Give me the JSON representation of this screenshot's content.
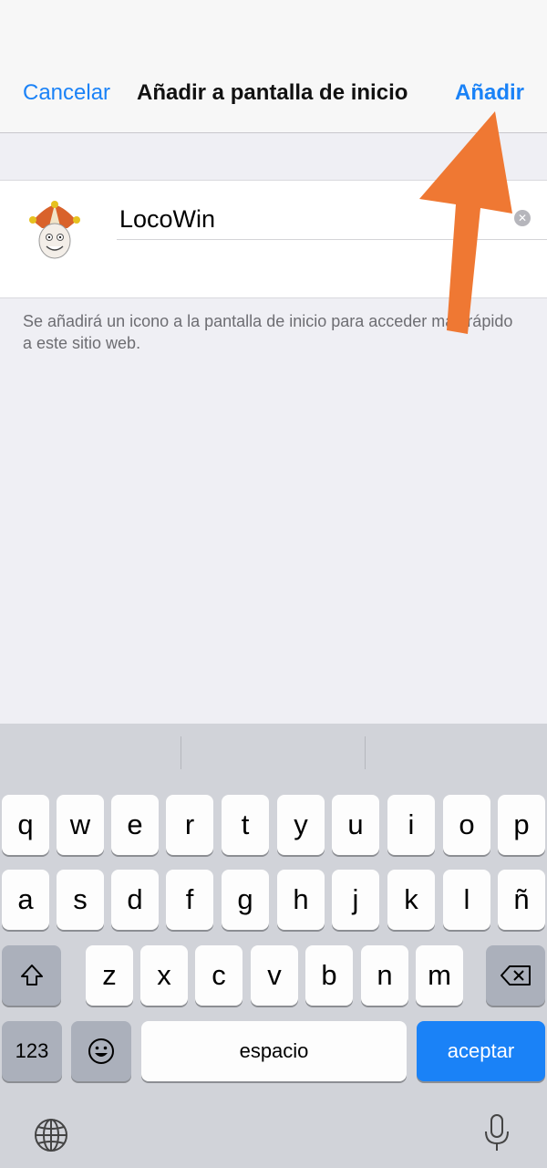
{
  "navbar": {
    "cancel_label": "Cancelar",
    "title": "Añadir a pantalla de inicio",
    "add_label": "Añadir"
  },
  "bookmark": {
    "icon": "jester-logo-icon",
    "name_value": "LocoWin",
    "hint": "Se añadirá un icono a la pantalla de inicio para acceder más rápido a este sitio web."
  },
  "keyboard": {
    "row1": [
      "q",
      "w",
      "e",
      "r",
      "t",
      "y",
      "u",
      "i",
      "o",
      "p"
    ],
    "row2": [
      "a",
      "s",
      "d",
      "f",
      "g",
      "h",
      "j",
      "k",
      "l",
      "ñ"
    ],
    "row3": [
      "z",
      "x",
      "c",
      "v",
      "b",
      "n",
      "m"
    ],
    "numbers_label": "123",
    "space_label": "espacio",
    "return_label": "aceptar",
    "icons": [
      "shift-icon",
      "backspace-icon",
      "emoji-icon",
      "globe-icon",
      "microphone-icon"
    ]
  },
  "colors": {
    "accent": "#1a82f7",
    "annotation_arrow": "#ef7833"
  }
}
